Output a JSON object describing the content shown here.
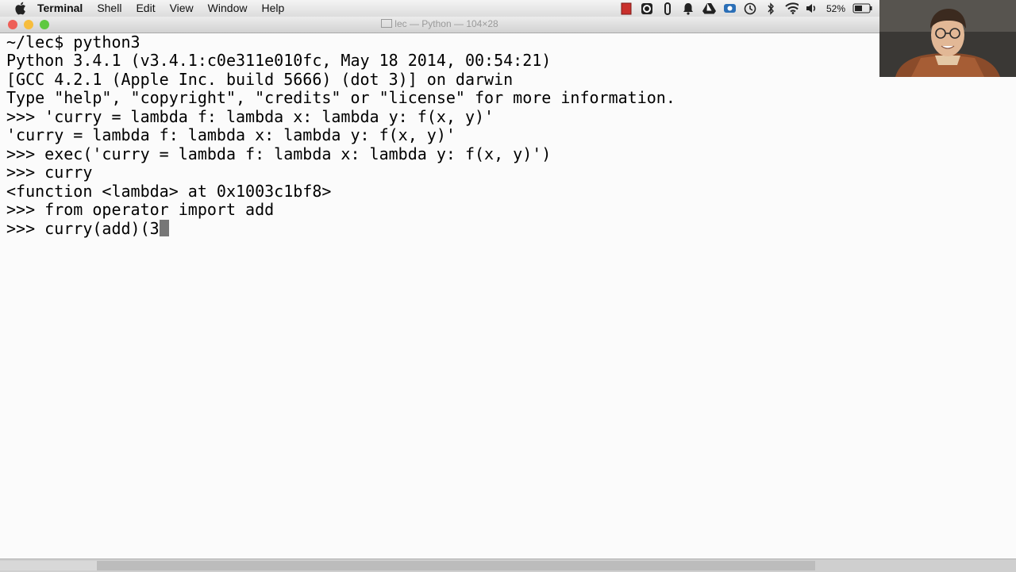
{
  "menubar": {
    "items": [
      {
        "label": "Terminal"
      },
      {
        "label": "Shell"
      },
      {
        "label": "Edit"
      },
      {
        "label": "View"
      },
      {
        "label": "Window"
      },
      {
        "label": "Help"
      }
    ],
    "battery": "52%"
  },
  "window": {
    "title": "lec — Python — 104×28"
  },
  "terminal": {
    "lines": [
      "~/lec$ python3",
      "Python 3.4.1 (v3.4.1:c0e311e010fc, May 18 2014, 00:54:21)",
      "[GCC 4.2.1 (Apple Inc. build 5666) (dot 3)] on darwin",
      "Type \"help\", \"copyright\", \"credits\" or \"license\" for more information.",
      ">>> 'curry = lambda f: lambda x: lambda y: f(x, y)'",
      "'curry = lambda f: lambda x: lambda y: f(x, y)'",
      ">>> exec('curry = lambda f: lambda x: lambda y: f(x, y)')",
      ">>> curry",
      "<function <lambda> at 0x1003c1bf8>",
      ">>> from operator import add",
      ">>> curry(add)(3"
    ]
  },
  "colors": {
    "close": "#ee5f57",
    "minimize": "#f7bd3c",
    "zoom": "#5fc840",
    "terminal_bg": "#fbfbfb",
    "cursor": "#777777"
  }
}
